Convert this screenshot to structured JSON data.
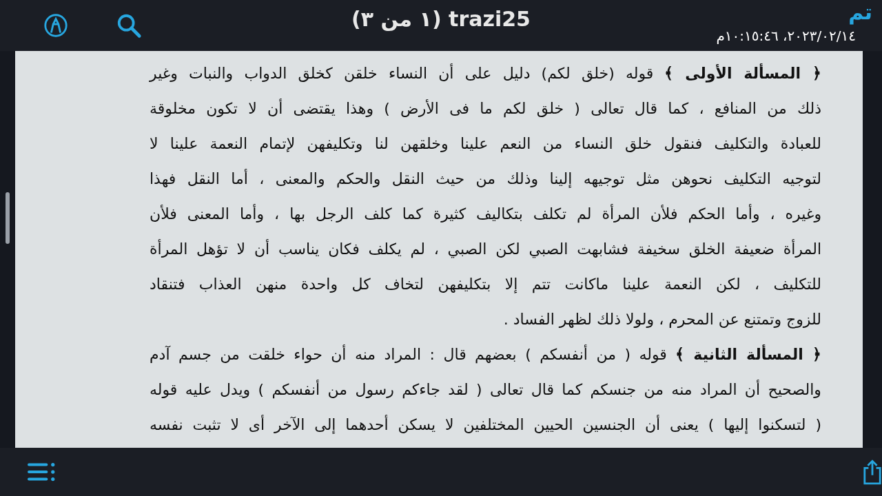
{
  "toolbar": {
    "title": "trazi25 (١ من ٣)",
    "done_button": "تم"
  },
  "date_stamp": "٢٠٢٣/٠٢/١٤، ١٠:١٥:٤٦م",
  "document": {
    "lines": [
      "**﴿ المسألة الأولى ﴾** قوله (خلق لكم) دليل على أن النساء خلقن كخلق الدواب والنبات وغير",
      "ذلك من المنافع ، كما قال تعالى ( خلق لكم ما فى الأرض ) وهذا يقتضى أن لا تكون مخلوقة",
      "للعبادة والتكليف فنقول خلق النساء من النعم علينا وخلقهن لنا وتكليفهن لإتمام النعمة علينا لا",
      "لتوجيه التكليف نحوهن مثل توجيهه إلينا وذلك من حيث النقل والحكم والمعنى ، أما النقل فهذا",
      "وغيره ، وأما الحكم فلأن المرأة لم تكلف بتكاليف كثيرة كما كلف الرجل بها ، وأما المعنى فلأن",
      "المرأة ضعيفة الخلق سخيفة فشابهت الصبي لكن الصبي ، لم يكلف فكان يناسب أن لا تؤهل المرأة",
      "للتكليف ، لكن النعمة علينا ماكانت تتم إلا بتكليفهن لتخاف كل واحدة منهن العذاب فتنقاد",
      "للزوج وتمتنع عن المحرم ، ولولا ذلك لظهر الفساد .",
      "**﴿ المسألة الثانية ﴾** قوله ( من أنفسكم ) بعضهم قال : المراد منه أن حواء خلقت من جسم آدم",
      "والصحيح أن المراد منه من جنسكم كما قال تعالى ( لقد جاءكم رسول من أنفسكم ) ويدل عليه قوله",
      "( لتسكنوا إليها ) يعنى أن الجنسين الحيين المختلفين لا يسكن أحدهما إلى الآخر أى لا تثبت نفسه"
    ]
  }
}
